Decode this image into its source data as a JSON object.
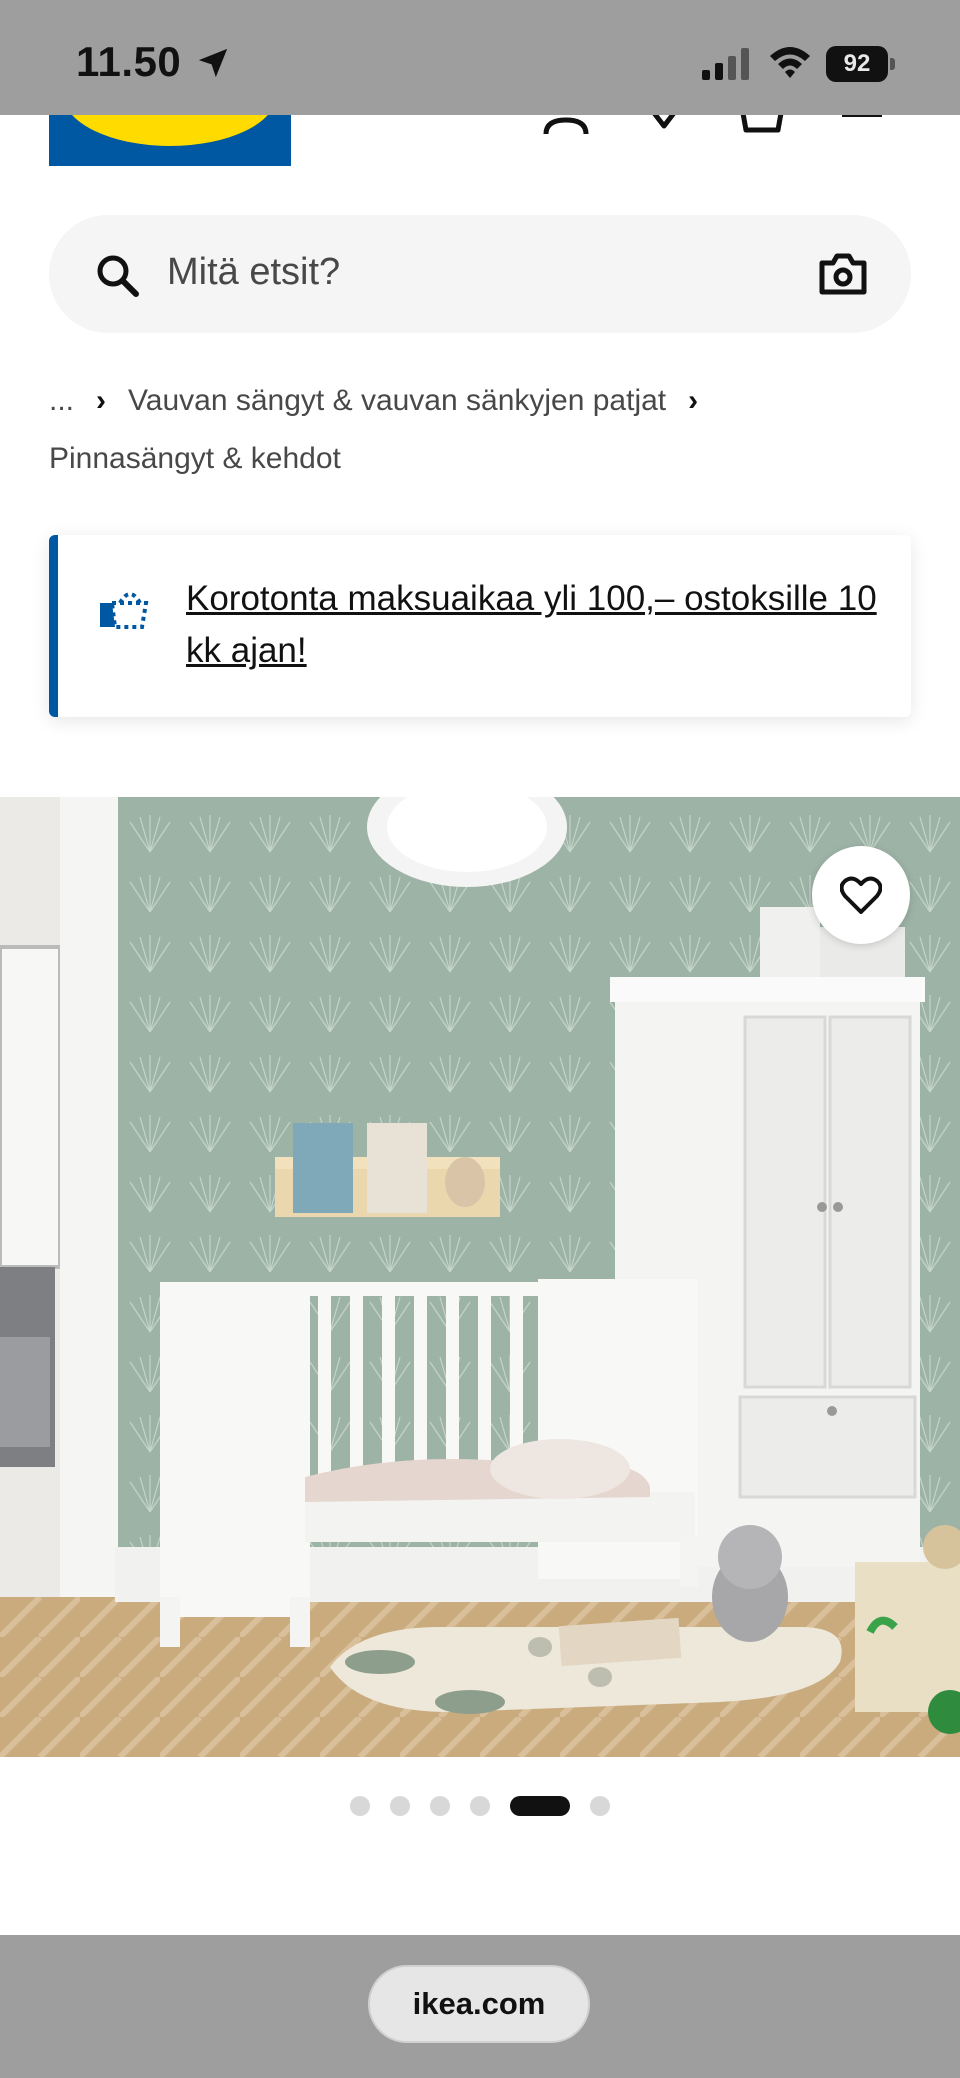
{
  "status_bar": {
    "time": "11.50",
    "battery": "92"
  },
  "header": {
    "logo_alt": "IKEA"
  },
  "search": {
    "placeholder": "Mitä etsit?"
  },
  "breadcrumb": {
    "ellipsis": "...",
    "level1": "Vauvan sängyt & vauvan sänkyjen patjat",
    "level2": "Pinnasängyt & kehdot"
  },
  "promo": {
    "text": "Korotonta maksuaikaa yli 100,– ostoksille 10 kk ajan!"
  },
  "carousel": {
    "total": 6,
    "active_index": 5
  },
  "browser": {
    "url": "ikea.com"
  },
  "colors": {
    "brand_blue": "#0058a3",
    "brand_yellow": "#ffdb00",
    "status_bar_gray": "#9e9e9e"
  }
}
